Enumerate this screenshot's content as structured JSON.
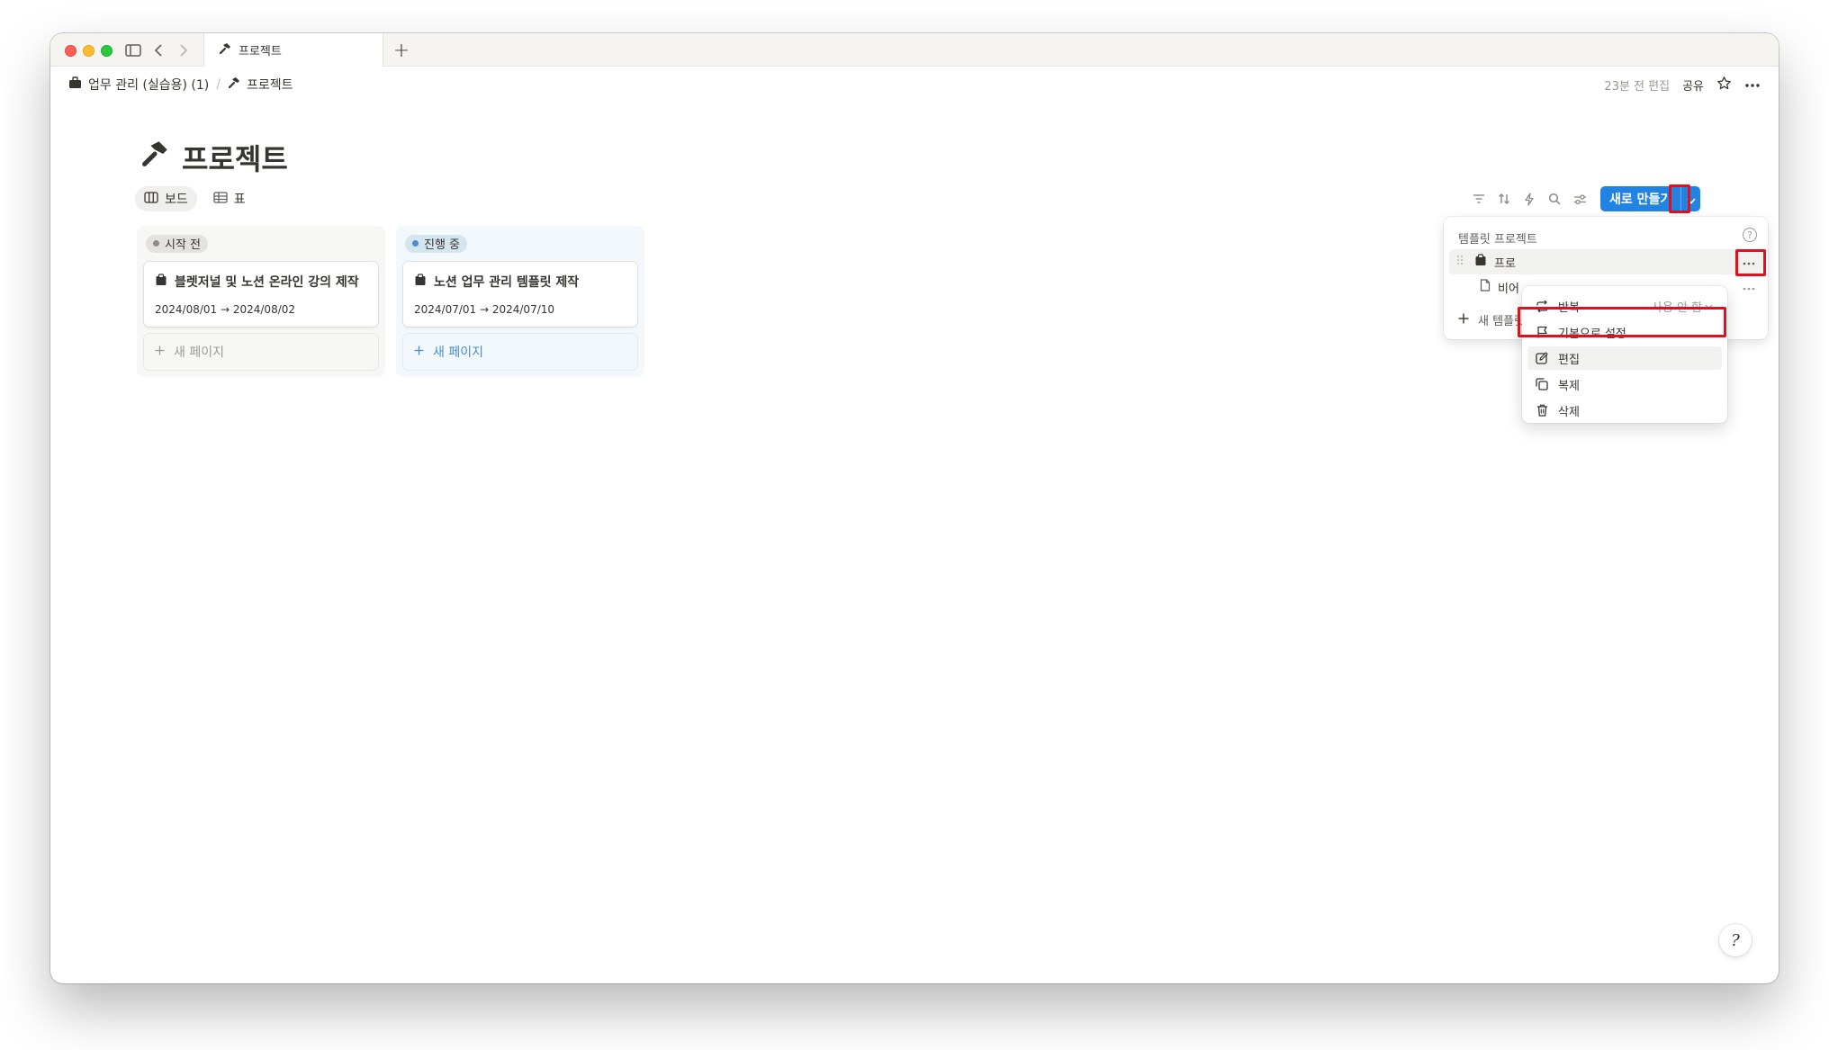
{
  "window": {
    "tab_title": "프로젝트"
  },
  "breadcrumb": {
    "items": [
      {
        "label": "업무 관리 (실습용) (1)",
        "icon": "briefcase-icon"
      },
      {
        "label": "프로젝트",
        "icon": "hammer-icon"
      }
    ],
    "separator": "/"
  },
  "topbar": {
    "edited": "23분 전 편집",
    "share": "공유"
  },
  "page": {
    "title": "프로젝트",
    "title_icon": "hammer-icon"
  },
  "views": [
    {
      "label": "보드",
      "icon": "board-icon",
      "active": true
    },
    {
      "label": "표",
      "icon": "table-icon",
      "active": false
    }
  ],
  "toolbar": {
    "new_button": "새로 만들기"
  },
  "board": {
    "columns": [
      {
        "status": "시작 전",
        "color": "#8e8b86",
        "cards": [
          {
            "title": "블렛저널 및 노션 온라인 강의 제작",
            "date": "2024/08/01 → 2024/08/02"
          }
        ],
        "add_label": "새 페이지"
      },
      {
        "status": "진행 중",
        "color": "#4a8dcc",
        "cards": [
          {
            "title": "노션 업무 관리 템플릿 제작",
            "date": "2024/07/01 → 2024/07/10"
          }
        ],
        "add_label": "새 페이지"
      }
    ]
  },
  "template_menu": {
    "heading": "템플릿 프로젝트",
    "help": "?",
    "items": [
      {
        "label": "프로",
        "icon": "clipboard-icon"
      },
      {
        "label": "비어",
        "icon": "page-icon"
      }
    ],
    "new_template": "새 템플릿"
  },
  "context_menu": {
    "items": [
      {
        "label": "반복",
        "icon": "repeat-icon",
        "value": "사용 안 함"
      },
      {
        "label": "기본으로 설정",
        "icon": "flag-icon"
      },
      {
        "label": "편집",
        "icon": "edit-icon"
      },
      {
        "label": "복제",
        "icon": "duplicate-icon"
      },
      {
        "label": "삭제",
        "icon": "trash-icon"
      }
    ]
  },
  "help_button": "?",
  "colors": {
    "accent": "#2383e2",
    "highlight": "#e0101d"
  }
}
